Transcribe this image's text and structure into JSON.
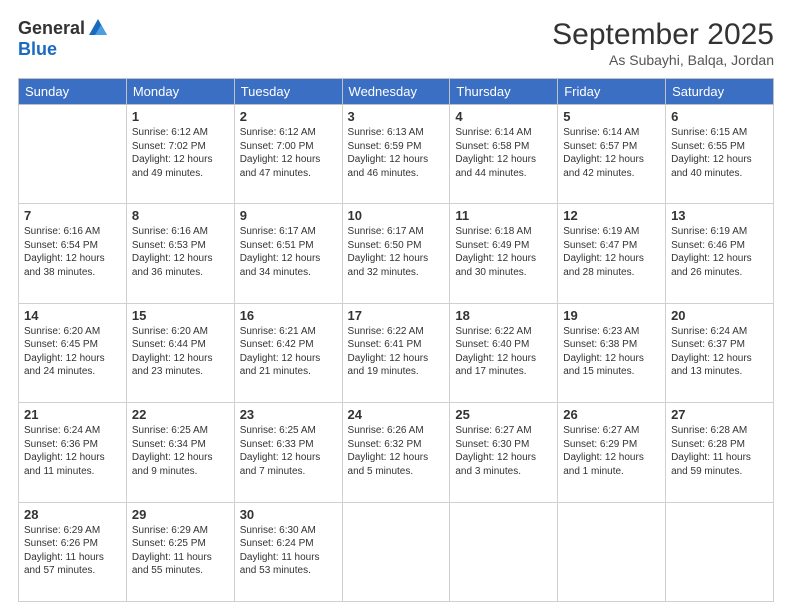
{
  "header": {
    "logo": {
      "general": "General",
      "blue": "Blue"
    },
    "title": "September 2025",
    "location": "As Subayhi, Balqa, Jordan"
  },
  "days_of_week": [
    "Sunday",
    "Monday",
    "Tuesday",
    "Wednesday",
    "Thursday",
    "Friday",
    "Saturday"
  ],
  "weeks": [
    [
      {
        "day": null,
        "content": ""
      },
      {
        "day": "1",
        "content": "Sunrise: 6:12 AM\nSunset: 7:02 PM\nDaylight: 12 hours\nand 49 minutes."
      },
      {
        "day": "2",
        "content": "Sunrise: 6:12 AM\nSunset: 7:00 PM\nDaylight: 12 hours\nand 47 minutes."
      },
      {
        "day": "3",
        "content": "Sunrise: 6:13 AM\nSunset: 6:59 PM\nDaylight: 12 hours\nand 46 minutes."
      },
      {
        "day": "4",
        "content": "Sunrise: 6:14 AM\nSunset: 6:58 PM\nDaylight: 12 hours\nand 44 minutes."
      },
      {
        "day": "5",
        "content": "Sunrise: 6:14 AM\nSunset: 6:57 PM\nDaylight: 12 hours\nand 42 minutes."
      },
      {
        "day": "6",
        "content": "Sunrise: 6:15 AM\nSunset: 6:55 PM\nDaylight: 12 hours\nand 40 minutes."
      }
    ],
    [
      {
        "day": "7",
        "content": "Sunrise: 6:16 AM\nSunset: 6:54 PM\nDaylight: 12 hours\nand 38 minutes."
      },
      {
        "day": "8",
        "content": "Sunrise: 6:16 AM\nSunset: 6:53 PM\nDaylight: 12 hours\nand 36 minutes."
      },
      {
        "day": "9",
        "content": "Sunrise: 6:17 AM\nSunset: 6:51 PM\nDaylight: 12 hours\nand 34 minutes."
      },
      {
        "day": "10",
        "content": "Sunrise: 6:17 AM\nSunset: 6:50 PM\nDaylight: 12 hours\nand 32 minutes."
      },
      {
        "day": "11",
        "content": "Sunrise: 6:18 AM\nSunset: 6:49 PM\nDaylight: 12 hours\nand 30 minutes."
      },
      {
        "day": "12",
        "content": "Sunrise: 6:19 AM\nSunset: 6:47 PM\nDaylight: 12 hours\nand 28 minutes."
      },
      {
        "day": "13",
        "content": "Sunrise: 6:19 AM\nSunset: 6:46 PM\nDaylight: 12 hours\nand 26 minutes."
      }
    ],
    [
      {
        "day": "14",
        "content": "Sunrise: 6:20 AM\nSunset: 6:45 PM\nDaylight: 12 hours\nand 24 minutes."
      },
      {
        "day": "15",
        "content": "Sunrise: 6:20 AM\nSunset: 6:44 PM\nDaylight: 12 hours\nand 23 minutes."
      },
      {
        "day": "16",
        "content": "Sunrise: 6:21 AM\nSunset: 6:42 PM\nDaylight: 12 hours\nand 21 minutes."
      },
      {
        "day": "17",
        "content": "Sunrise: 6:22 AM\nSunset: 6:41 PM\nDaylight: 12 hours\nand 19 minutes."
      },
      {
        "day": "18",
        "content": "Sunrise: 6:22 AM\nSunset: 6:40 PM\nDaylight: 12 hours\nand 17 minutes."
      },
      {
        "day": "19",
        "content": "Sunrise: 6:23 AM\nSunset: 6:38 PM\nDaylight: 12 hours\nand 15 minutes."
      },
      {
        "day": "20",
        "content": "Sunrise: 6:24 AM\nSunset: 6:37 PM\nDaylight: 12 hours\nand 13 minutes."
      }
    ],
    [
      {
        "day": "21",
        "content": "Sunrise: 6:24 AM\nSunset: 6:36 PM\nDaylight: 12 hours\nand 11 minutes."
      },
      {
        "day": "22",
        "content": "Sunrise: 6:25 AM\nSunset: 6:34 PM\nDaylight: 12 hours\nand 9 minutes."
      },
      {
        "day": "23",
        "content": "Sunrise: 6:25 AM\nSunset: 6:33 PM\nDaylight: 12 hours\nand 7 minutes."
      },
      {
        "day": "24",
        "content": "Sunrise: 6:26 AM\nSunset: 6:32 PM\nDaylight: 12 hours\nand 5 minutes."
      },
      {
        "day": "25",
        "content": "Sunrise: 6:27 AM\nSunset: 6:30 PM\nDaylight: 12 hours\nand 3 minutes."
      },
      {
        "day": "26",
        "content": "Sunrise: 6:27 AM\nSunset: 6:29 PM\nDaylight: 12 hours\nand 1 minute."
      },
      {
        "day": "27",
        "content": "Sunrise: 6:28 AM\nSunset: 6:28 PM\nDaylight: 11 hours\nand 59 minutes."
      }
    ],
    [
      {
        "day": "28",
        "content": "Sunrise: 6:29 AM\nSunset: 6:26 PM\nDaylight: 11 hours\nand 57 minutes."
      },
      {
        "day": "29",
        "content": "Sunrise: 6:29 AM\nSunset: 6:25 PM\nDaylight: 11 hours\nand 55 minutes."
      },
      {
        "day": "30",
        "content": "Sunrise: 6:30 AM\nSunset: 6:24 PM\nDaylight: 11 hours\nand 53 minutes."
      },
      {
        "day": null,
        "content": ""
      },
      {
        "day": null,
        "content": ""
      },
      {
        "day": null,
        "content": ""
      },
      {
        "day": null,
        "content": ""
      }
    ]
  ]
}
